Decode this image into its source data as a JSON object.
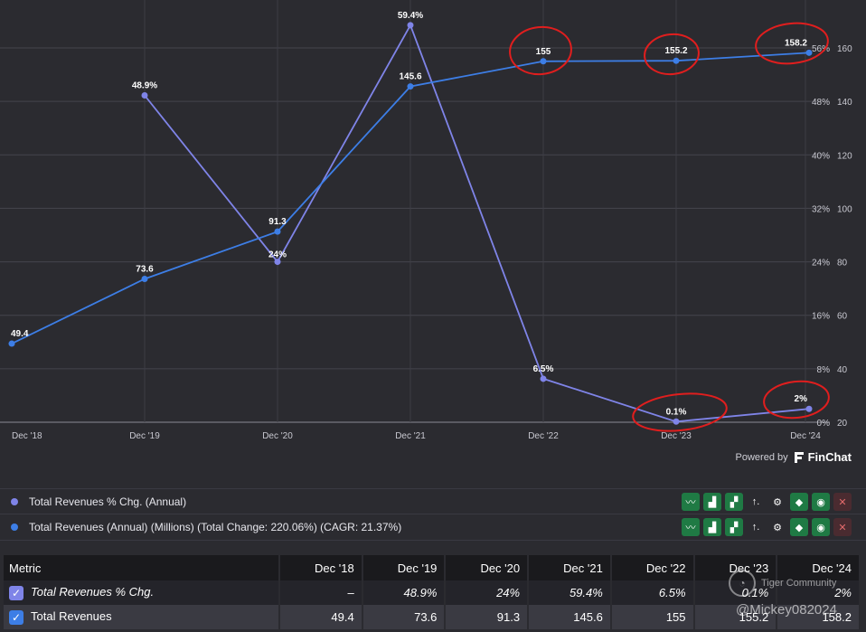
{
  "chart_data": {
    "type": "line",
    "categories": [
      "Dec '18",
      "Dec '19",
      "Dec '20",
      "Dec '21",
      "Dec '22",
      "Dec '23",
      "Dec '24"
    ],
    "series": [
      {
        "name": "Total Revenues % Chg. (Annual)",
        "axis": "left",
        "color": "#7f84e8",
        "values": [
          null,
          48.9,
          24,
          59.4,
          6.5,
          0.1,
          2
        ],
        "labels": [
          "",
          "48.9%",
          "24%",
          "59.4%",
          "6.5%",
          "0.1%",
          "2%"
        ]
      },
      {
        "name": "Total Revenues (Annual) (Millions) (Total Change: 220.06%) (CAGR: 21.37%)",
        "axis": "right",
        "color": "#3d7ee6",
        "values": [
          49.4,
          73.6,
          91.3,
          145.6,
          155,
          155.2,
          158.2
        ],
        "labels": [
          "49.4",
          "73.6",
          "91.3",
          "145.6",
          "155",
          "155.2",
          "158.2"
        ]
      }
    ],
    "left_axis": {
      "ticks": [
        "0%",
        "8%",
        "16%",
        "24%",
        "32%",
        "40%",
        "48%",
        "56%"
      ],
      "ylim": [
        0,
        56
      ]
    },
    "right_axis": {
      "ticks": [
        "20",
        "40",
        "60",
        "80",
        "100",
        "120",
        "140",
        "160"
      ],
      "ylim": [
        20,
        160
      ]
    },
    "grid": true,
    "annotation_color": "#e01e1e"
  },
  "powered_by": {
    "label": "Powered by",
    "brand": "FinChat"
  },
  "legend": [
    {
      "label": "Total Revenues % Chg. (Annual)",
      "color": "#7f84e8"
    },
    {
      "label": "Total Revenues (Annual) (Millions) (Total Change: 220.06%) (CAGR: 21.37%)",
      "color": "#3d7ee6"
    }
  ],
  "tools": [
    {
      "icon": "trend-line-icon",
      "glyph": "〰"
    },
    {
      "icon": "bar-chart-icon",
      "glyph": "▟"
    },
    {
      "icon": "stacked-bar-icon",
      "glyph": "▞"
    },
    {
      "icon": "sort-icon",
      "glyph": "↑."
    },
    {
      "icon": "gear-icon",
      "glyph": "⚙"
    },
    {
      "icon": "tag-icon",
      "glyph": "◆"
    },
    {
      "icon": "eye-icon",
      "glyph": "◉"
    },
    {
      "icon": "close-icon",
      "glyph": "✕"
    }
  ],
  "table": {
    "headers": [
      "Metric",
      "Dec '18",
      "Dec '19",
      "Dec '20",
      "Dec '21",
      "Dec '22",
      "Dec '23",
      "Dec '24"
    ],
    "rows": [
      {
        "metric": "Total Revenues % Chg.",
        "checkbox_color": "#7f84e8",
        "cells": [
          "–",
          "48.9%",
          "24%",
          "59.4%",
          "6.5%",
          "0.1%",
          "2%"
        ]
      },
      {
        "metric": "Total Revenues",
        "checkbox_color": "#3d7ee6",
        "cells": [
          "49.4",
          "73.6",
          "91.3",
          "145.6",
          "155",
          "155.2",
          "158.2"
        ]
      }
    ]
  },
  "watermark": {
    "community": "Tiger Community",
    "user": "@Mickey082024"
  }
}
